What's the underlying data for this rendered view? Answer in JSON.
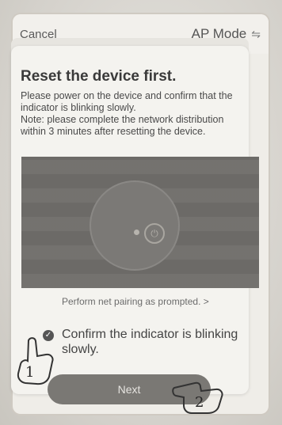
{
  "header": {
    "cancel_label": "Cancel",
    "mode_label": "AP Mode",
    "mode_icon": "swap-icon"
  },
  "content": {
    "title": "Reset the device first.",
    "description": "Please power on the device and confirm that the indicator is blinking slowly.\nNote: please complete the network distribution within 3 minutes after resetting the device.",
    "pairing_link": "Perform net pairing as prompted. >",
    "confirm_label": "Confirm the indicator is blinking slowly.",
    "next_label": "Next"
  },
  "annotations": {
    "step_1": "1",
    "step_2": "2"
  },
  "colors": {
    "button_bg": "#7a7874",
    "illustration_bg": "#6f6d6a",
    "text_primary": "#3a3a3a"
  }
}
